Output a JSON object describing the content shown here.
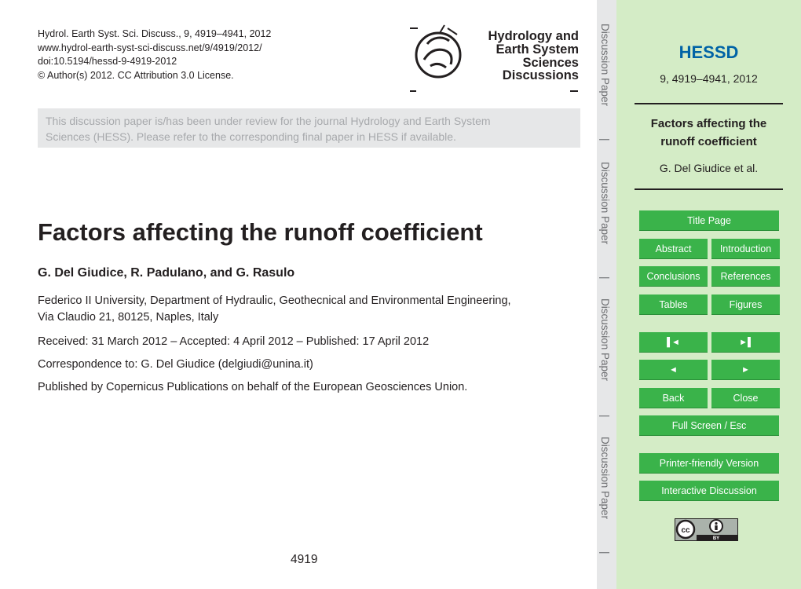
{
  "header_meta": {
    "journal_line": "Hydrol. Earth Syst. Sci. Discuss., 9, 4919–4941, 2012",
    "url": "www.hydrol-earth-syst-sci-discuss.net/9/4919/2012/",
    "doi": "doi:10.5194/hessd-9-4919-2012",
    "copyright": "© Author(s) 2012. CC Attribution 3.0 License."
  },
  "logo": {
    "line1": "Hydrology and",
    "line2": "Earth System",
    "line3": "Sciences",
    "line4": "Discussions"
  },
  "notice": {
    "line1": "This discussion paper is/has been under review for the journal Hydrology and Earth System",
    "line2": "Sciences (HESS). Please refer to the corresponding final paper in HESS if available."
  },
  "paper": {
    "title": "Factors affecting the runoff coefficient",
    "authors": "G. Del Giudice, R. Padulano, and G. Rasulo",
    "affiliation_line1": "Federico II University, Department of Hydraulic, Geothecnical and Environmental Engineering,",
    "affiliation_line2": "Via Claudio 21, 80125, Naples, Italy",
    "received": "Received: 31 March 2012 – Accepted: 4 April 2012 – Published: 17 April 2012",
    "correspondence": "Correspondence to: G. Del Giudice (delgiudi@unina.it)",
    "published_by": "Published by Copernicus Publications on behalf of the European Geosciences Union."
  },
  "page_number": "4919",
  "vertical_labels": [
    "Discussion Paper",
    "|",
    "Discussion Paper",
    "|",
    "Discussion Paper",
    "|",
    "Discussion Paper",
    "|"
  ],
  "sidebar": {
    "journal": "HESSD",
    "pages": "9, 4919–4941, 2012",
    "title_line1": "Factors affecting the",
    "title_line2": "runoff coefficient",
    "author": "G. Del Giudice et al.",
    "buttons": {
      "title_page": "Title Page",
      "abstract": "Abstract",
      "introduction": "Introduction",
      "conclusions": "Conclusions",
      "references": "References",
      "tables": "Tables",
      "figures": "Figures",
      "first": "◄",
      "last": "►",
      "prev": "◄",
      "next": "►",
      "back": "Back",
      "close": "Close",
      "full_screen": "Full Screen / Esc",
      "printer": "Printer-friendly Version",
      "interactive": "Interactive Discussion"
    },
    "license_badge": "BY"
  },
  "colors": {
    "sidebar_bg": "#d4ecc6",
    "button_green": "#3ab34a",
    "journal_blue": "#0063a6",
    "notice_bg": "#e6e7e8"
  }
}
